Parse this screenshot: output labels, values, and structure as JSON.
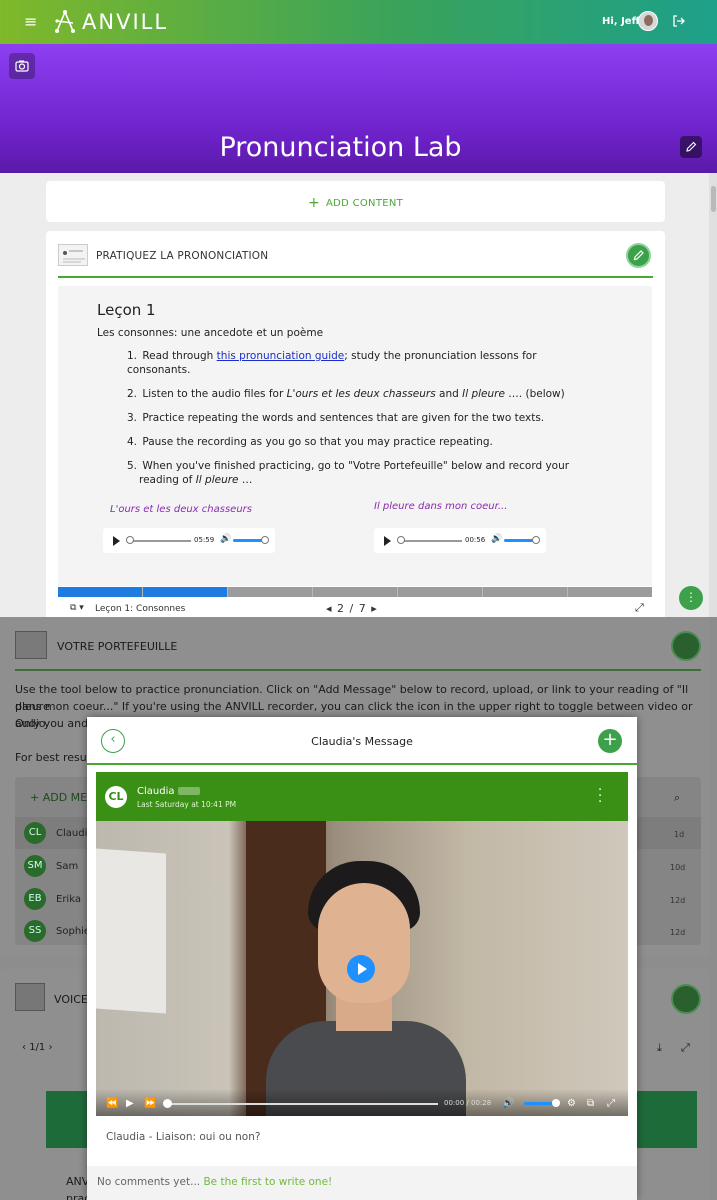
{
  "header": {
    "app_name": "ANVILL",
    "greeting": "Hi, Jeff",
    "menu_icon": "hamburger-icon",
    "logout_icon": "logout-icon"
  },
  "banner": {
    "title": "Pronunciation Lab"
  },
  "add_content": {
    "label": "ADD CONTENT"
  },
  "practice_card": {
    "title": "PRATIQUEZ LA PRONONCIATION",
    "lesson": {
      "heading": "Leçon 1",
      "subheading": "Les consonnes: une ancedote et un poème",
      "steps": [
        {
          "num": "1.",
          "pre": "Read through ",
          "link": "this pronunciation guide",
          "post": "; study the pronunciation lessons for consonants."
        },
        {
          "num": "2.",
          "pre": "Listen to the audio files for ",
          "em1": "L'ours et les deux chasseurs",
          "mid": " and ",
          "em2": "Il pleure",
          "post": " …. (below)"
        },
        {
          "num": "3.",
          "text": "Practice repeating the words and sentences that are given for the two texts."
        },
        {
          "num": "4.",
          "text": "Pause the recording as you go so that you may practice repeating."
        },
        {
          "num": "5.",
          "line1": "When you've finished practicing, go to \"Votre Portefeuille\" below and record your",
          "line2_pre": "reading of ",
          "line2_em": "Il pleure",
          "line2_post": " …"
        }
      ],
      "audio": [
        {
          "title": "L'ours et les deux chasseurs",
          "time": "05:59"
        },
        {
          "title": "Il pleure dans mon coeur...",
          "time": "00:56"
        }
      ]
    },
    "slides": {
      "label": "Leçon 1: Consonnes",
      "current": "2",
      "total": "7",
      "pager": "2 / 7"
    }
  },
  "portfolio": {
    "title": "VOTRE PORTEFEUILLE",
    "intro_line1": "Use the tool below to practice pronunciation. Click on \"Add Message\" below to record, upload, or link to your reading of \"Il pleure",
    "intro_line2": "dans mon coeur...\" If you're using the ANVILL recorder, you can click the icon in the upper right to toggle between video or audio.",
    "intro_line3": "Only you and",
    "best_results": "For best result",
    "add_message": "ADD ME",
    "students": [
      {
        "initials": "CL",
        "name": "Claudia",
        "ago": "1d"
      },
      {
        "initials": "SM",
        "name": "Sam",
        "ago": "10d"
      },
      {
        "initials": "EB",
        "name": "Erika",
        "ago": "12d"
      },
      {
        "initials": "SS",
        "name": "Sophie",
        "ago": "12d"
      }
    ]
  },
  "voice_section": {
    "title": "VOICE",
    "pager": "1/1",
    "body_fragment_1": "ANV",
    "body_fragment_2": "prac"
  },
  "modal": {
    "title": "Claudia's Message",
    "author": "Claudia",
    "initials": "CL",
    "timestamp": "Last Saturday at 10:41 PM",
    "video_time": "00:00",
    "video_duration": "00:28",
    "caption": "Claudia - Liaison: oui ou non?",
    "comments_empty": "No comments yet...",
    "comments_cta": "Be the first to write one!"
  },
  "colors": {
    "brand_green": "#3da04a",
    "banner_purple": "#7b2fe0",
    "link_blue": "#1a2ec9",
    "audio_title_purple": "#8b2ab3",
    "progress_blue": "#1e7be0"
  }
}
